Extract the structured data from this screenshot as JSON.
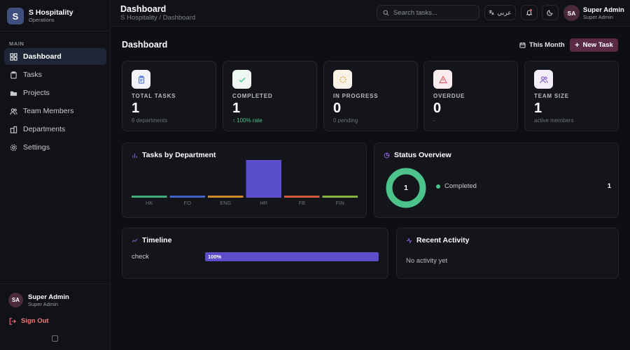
{
  "brand": {
    "logo_letter": "S",
    "name": "S Hospitality",
    "subtitle": "Operations"
  },
  "sidebar": {
    "section_label": "MAIN",
    "items": [
      {
        "label": "Dashboard",
        "icon": "dashboard-icon",
        "active": true
      },
      {
        "label": "Tasks",
        "icon": "clipboard-icon"
      },
      {
        "label": "Projects",
        "icon": "folder-icon"
      },
      {
        "label": "Team Members",
        "icon": "users-icon"
      },
      {
        "label": "Departments",
        "icon": "building-icon"
      },
      {
        "label": "Settings",
        "icon": "gear-icon"
      }
    ],
    "user": {
      "initials": "SA",
      "name": "Super Admin",
      "role": "Super Admin"
    },
    "sign_out": "Sign Out"
  },
  "topbar": {
    "title": "Dashboard",
    "breadcrumb": "S Hospitality / Dashboard",
    "search_placeholder": "Search tasks...",
    "language_label": "عربي",
    "user": {
      "initials": "SA",
      "name": "Super Admin",
      "role": "Super Admin"
    }
  },
  "main": {
    "title": "Dashboard",
    "period_button": "This Month",
    "new_task_button": "New Task"
  },
  "stats": [
    {
      "label": "TOTAL TASKS",
      "value": "1",
      "sub": "6 departments",
      "icon": "clipboard-icon",
      "color": "#5b7bd5"
    },
    {
      "label": "COMPLETED",
      "value": "1",
      "sub": "100% rate",
      "icon": "check-icon",
      "color": "#4cc38a"
    },
    {
      "label": "IN PROGRESS",
      "value": "0",
      "sub": "0 pending",
      "icon": "loader-icon",
      "color": "#e0a43a"
    },
    {
      "label": "OVERDUE",
      "value": "0",
      "sub": "-",
      "icon": "alert-triangle-icon",
      "color": "#e25d6b"
    },
    {
      "label": "TEAM SIZE",
      "value": "1",
      "sub": "active members",
      "icon": "users-icon",
      "color": "#8a63d2"
    }
  ],
  "tasks_by_department": {
    "title": "Tasks by Department",
    "chart_data": {
      "type": "bar",
      "categories": [
        "HK",
        "FO",
        "ENG",
        "HR",
        "FB",
        "FIN"
      ],
      "values": [
        0,
        0,
        0,
        1,
        0,
        0
      ],
      "colors": [
        "#3fae7a",
        "#3f63c9",
        "#d08a2e",
        "#5a4fc9",
        "#d45a3e",
        "#86b53a"
      ],
      "ylim": [
        0,
        1
      ]
    }
  },
  "status_overview": {
    "title": "Status Overview",
    "total": "1",
    "items": [
      {
        "label": "Completed",
        "count": "1",
        "color": "#4cc38a"
      }
    ]
  },
  "timeline": {
    "title": "Timeline",
    "rows": [
      {
        "label": "check",
        "progress": 100,
        "progress_label": "100%"
      }
    ]
  },
  "recent_activity": {
    "title": "Recent Activity",
    "empty_text": "No activity yet"
  }
}
